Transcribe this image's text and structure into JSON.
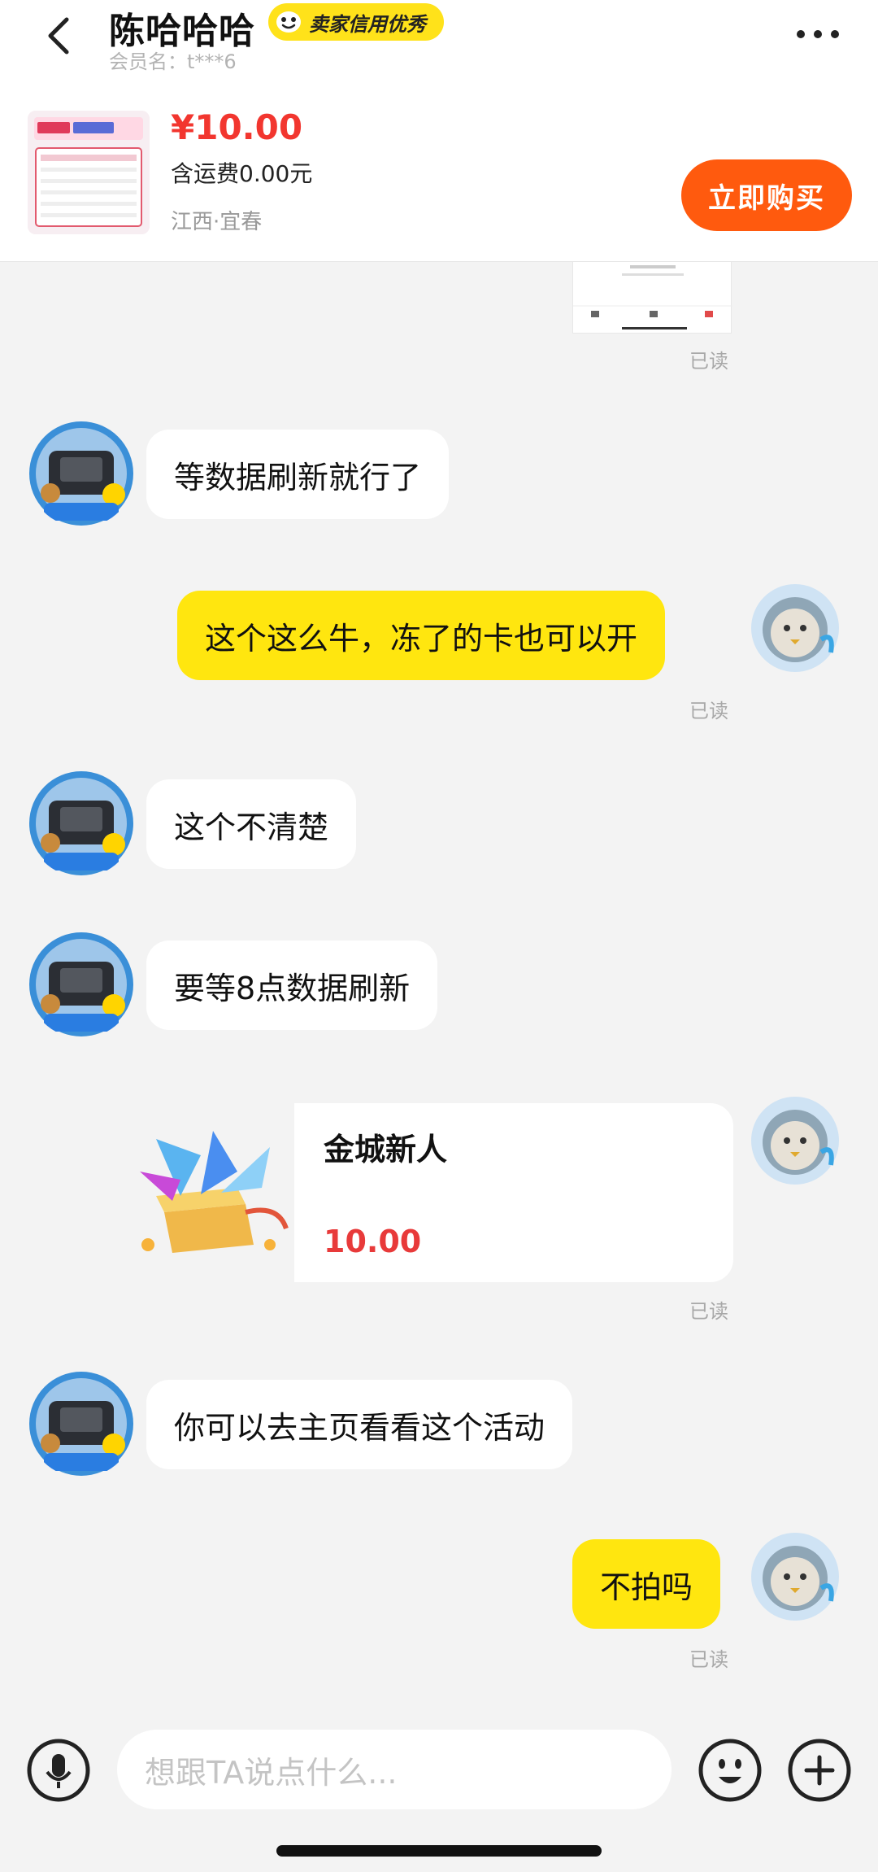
{
  "header": {
    "title": "陈哈哈哈",
    "badge": "卖家信用优秀",
    "member": "会员名：t***6"
  },
  "product": {
    "price": "¥10.00",
    "shipping": "含运费0.00元",
    "location": "江西·宜春",
    "buy_label": "立即购买"
  },
  "messages": [
    {
      "side": "in",
      "text": "等数据刷新就行了"
    },
    {
      "side": "out",
      "text": "这个这么牛，冻了的卡也可以开"
    },
    {
      "side": "in",
      "text": "这个不清楚"
    },
    {
      "side": "in",
      "text": "要等8点数据刷新"
    },
    {
      "side": "in",
      "text": "你可以去主页看看这个活动"
    },
    {
      "side": "out",
      "text": "不拍吗"
    }
  ],
  "card": {
    "title": "金城新人",
    "amount": "10.00"
  },
  "read_label": "已读",
  "input": {
    "placeholder": "想跟TA说点什么..."
  },
  "colors": {
    "accent_yellow": "#ffe60f",
    "buy_orange": "#ff5a0e",
    "price_red": "#f2362f"
  }
}
